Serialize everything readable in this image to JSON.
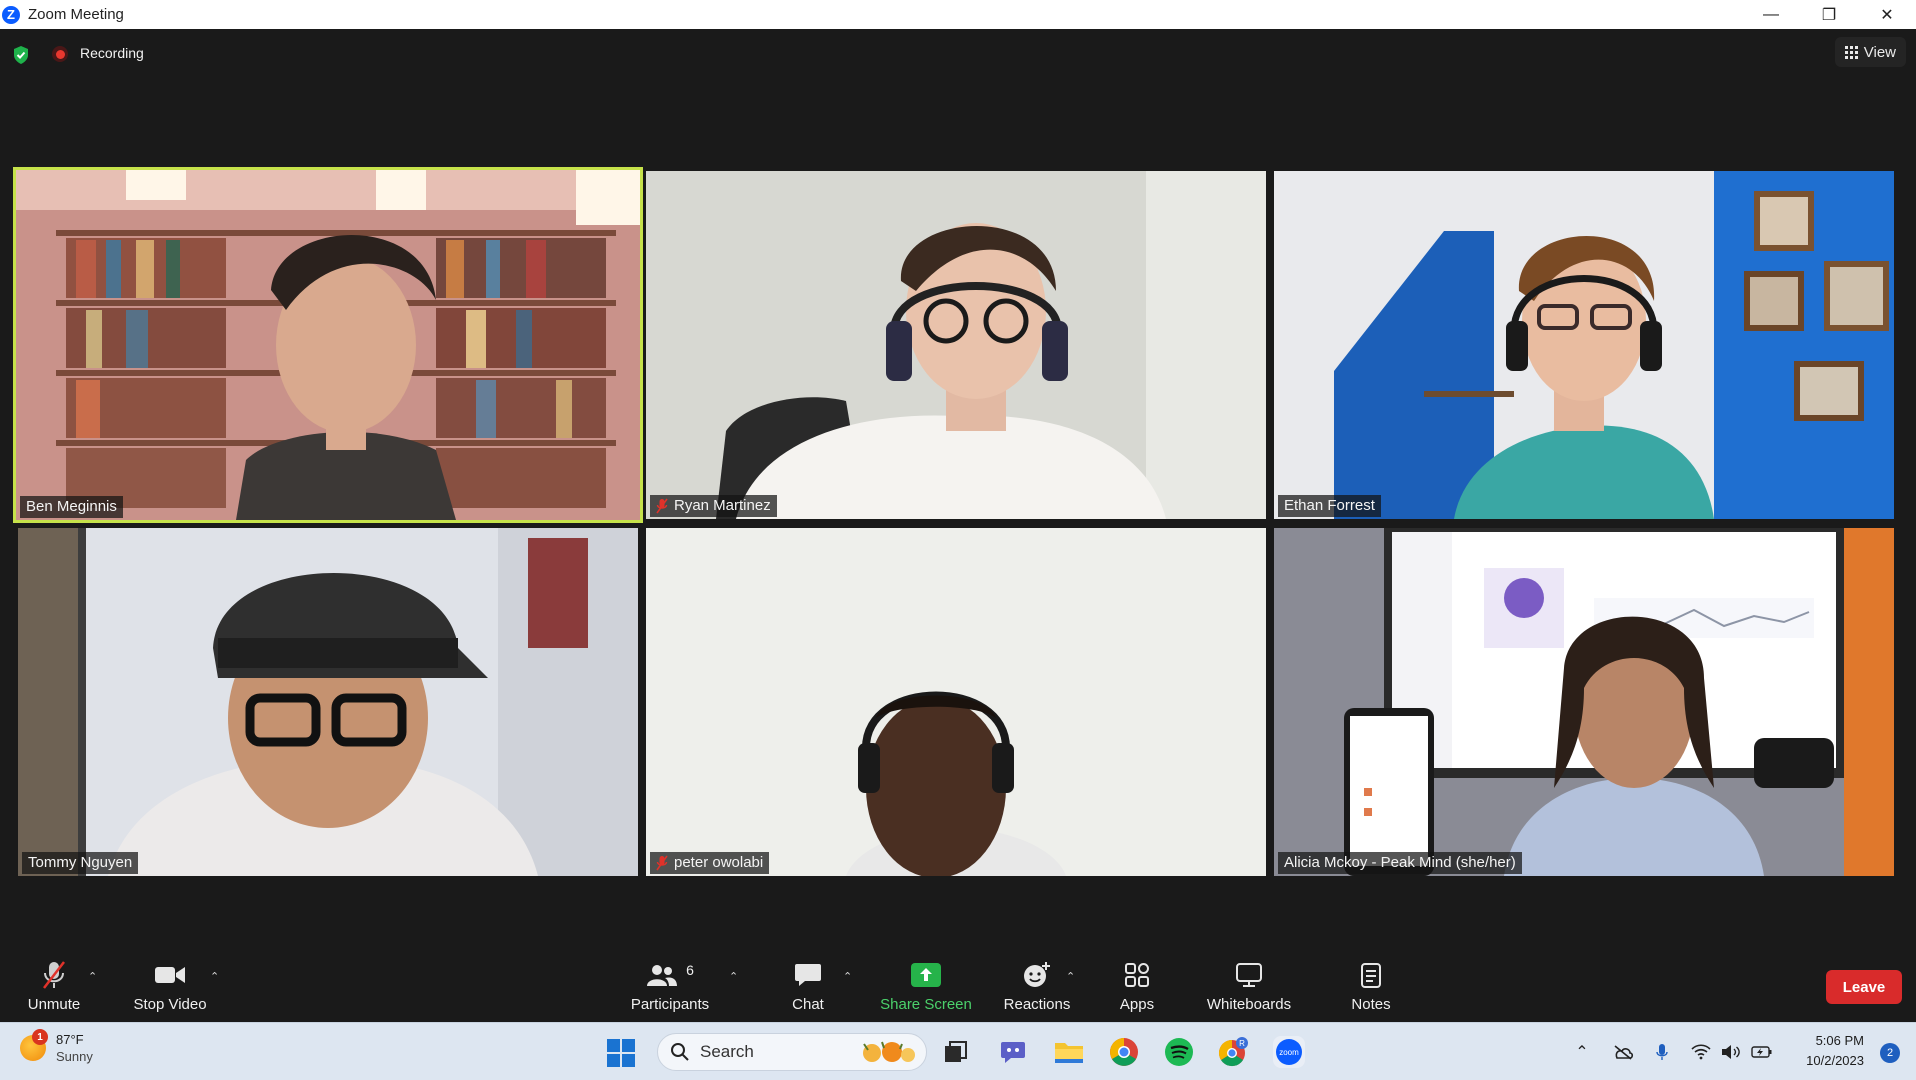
{
  "window": {
    "title": "Zoom Meeting",
    "controls": [
      "minimize",
      "restore",
      "close"
    ]
  },
  "meeting": {
    "recording_label": "Recording",
    "view_label": "View"
  },
  "participants": [
    {
      "name": "Ben Meginnis",
      "muted": false,
      "active_speaker": true
    },
    {
      "name": "Ryan Martinez",
      "muted": true,
      "active_speaker": false
    },
    {
      "name": "Ethan Forrest",
      "muted": false,
      "active_speaker": false
    },
    {
      "name": "Tommy Nguyen",
      "muted": false,
      "active_speaker": false
    },
    {
      "name": "peter owolabi",
      "muted": true,
      "active_speaker": false
    },
    {
      "name": "Alicia Mckoy - Peak Mind (she/her)",
      "muted": false,
      "active_speaker": false
    }
  ],
  "toolbar": {
    "unmute": "Unmute",
    "stop_video": "Stop Video",
    "participants": "Participants",
    "participants_count": "6",
    "chat": "Chat",
    "share_screen": "Share Screen",
    "reactions": "Reactions",
    "apps": "Apps",
    "whiteboards": "Whiteboards",
    "notes": "Notes",
    "leave": "Leave"
  },
  "taskbar": {
    "weather_temp": "87°F",
    "weather_cond": "Sunny",
    "weather_badge": "1",
    "search_label": "Search",
    "time": "5:06 PM",
    "date": "10/2/2023",
    "notification_count": "2"
  },
  "colors": {
    "active_speaker_border": "#c6e24a",
    "share_green": "#4bd16b",
    "leave_red": "#d92b2b",
    "muted_red": "#e0322a"
  }
}
